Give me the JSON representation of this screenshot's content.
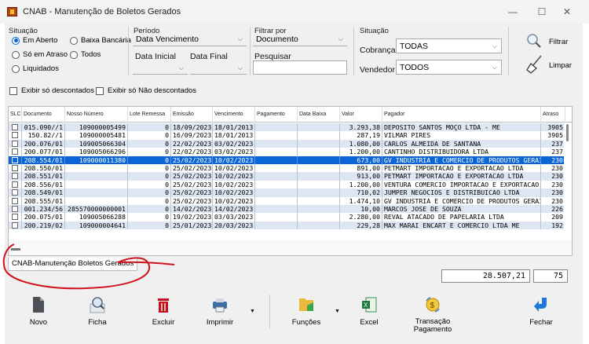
{
  "window": {
    "title": "CNAB - Manutenção de Boletos Gerados",
    "minimize": "—",
    "maximize": "☐",
    "close": "✕"
  },
  "situacao": {
    "label": "Situação",
    "options": [
      "Em Aberto",
      "Baixa Bancária",
      "Só em Atraso",
      "Todos",
      "Liquidados"
    ],
    "selected": "Em Aberto"
  },
  "periodo": {
    "label": "Período",
    "type_value": "Data Vencimento",
    "data_inicial_label": "Data Inicial",
    "data_final_label": "Data Final"
  },
  "filtrar": {
    "label": "Filtrar por",
    "value": "Documento",
    "pesquisar_label": "Pesquisar"
  },
  "situacao2": {
    "label": "Situação",
    "cobranca_label": "Cobrança",
    "cobranca_value": "TODAS",
    "vendedor_label": "Vendedor",
    "vendedor_value": "TODOS"
  },
  "actions": {
    "filtrar": "Filtrar",
    "limpar": "Limpar"
  },
  "checks": {
    "descontados": "Exibir só  descontados",
    "nao_descontados": "Exibir só Não descontados"
  },
  "grid": {
    "columns": [
      "SLC",
      "Documento",
      "Nosso Número",
      "Lote Remessa",
      "Emissão",
      "Vencimento",
      "Pagamento",
      "Data Baixa",
      "Valor",
      "Pagador",
      "Atraso"
    ],
    "rows": [
      {
        "doc": "015.090//1",
        "nosso": "109000005499",
        "lote": "0",
        "emissao": "18/09/2023",
        "venc": "18/01/2013",
        "pag": "",
        "baixa": "",
        "valor": "3.293,38",
        "pagador": "DEPOSITO SANTOS MOÇO LTDA - ME",
        "atraso": "3905"
      },
      {
        "doc": "150.82//1",
        "nosso": "109000005481",
        "lote": "0",
        "emissao": "16/09/2023",
        "venc": "18/01/2013",
        "pag": "",
        "baixa": "",
        "valor": "287,19",
        "pagador": "VILMAR PIRES",
        "atraso": "3905"
      },
      {
        "doc": "200.076/01",
        "nosso": "109005066304",
        "lote": "0",
        "emissao": "22/02/2023",
        "venc": "03/02/2023",
        "pag": "",
        "baixa": "",
        "valor": "1.080,00",
        "pagador": "CARLOS ALMEIDA DE SANTANA",
        "atraso": "237"
      },
      {
        "doc": "200.077/01",
        "nosso": "109005066296",
        "lote": "0",
        "emissao": "22/02/2023",
        "venc": "03/02/2023",
        "pag": "",
        "baixa": "",
        "valor": "1.200,00",
        "pagador": "CANTINHO DISTRIBUIDORA LTDA",
        "atraso": "237"
      },
      {
        "doc": "208.554/01",
        "nosso": "109000011380",
        "lote": "0",
        "emissao": "25/02/2023",
        "venc": "10/02/2023",
        "pag": "",
        "baixa": "",
        "valor": "673,00",
        "pagador": "GV INDUSTRIA E COMERCIO DE PRODUTOS GERAI",
        "atraso": "230"
      },
      {
        "doc": "208.550/01",
        "nosso": "",
        "lote": "0",
        "emissao": "25/02/2023",
        "venc": "10/02/2023",
        "pag": "",
        "baixa": "",
        "valor": "891,00",
        "pagador": "PETMART IMPORTACAO E EXPORTACAO LTDA",
        "atraso": "230"
      },
      {
        "doc": "208.551/01",
        "nosso": "",
        "lote": "0",
        "emissao": "25/02/2023",
        "venc": "10/02/2023",
        "pag": "",
        "baixa": "",
        "valor": "913,00",
        "pagador": "PETMART IMPORTACAO E EXPORTACAO LTDA",
        "atraso": "230"
      },
      {
        "doc": "208.556/01",
        "nosso": "",
        "lote": "0",
        "emissao": "25/02/2023",
        "venc": "10/02/2023",
        "pag": "",
        "baixa": "",
        "valor": "1.200,00",
        "pagador": "VENTURA COMERCIO IMPORTACAO E EXPORTACAO",
        "atraso": "230"
      },
      {
        "doc": "208.549/01",
        "nosso": "",
        "lote": "0",
        "emissao": "25/02/2023",
        "venc": "10/02/2023",
        "pag": "",
        "baixa": "",
        "valor": "710,02",
        "pagador": "JUMPER NEGOCIOS E DISTRIBUICAO LTDA",
        "atraso": "230"
      },
      {
        "doc": "208.555/01",
        "nosso": "",
        "lote": "0",
        "emissao": "25/02/2023",
        "venc": "10/02/2023",
        "pag": "",
        "baixa": "",
        "valor": "1.474,10",
        "pagador": "GV INDUSTRIA E COMERCIO DE PRODUTOS GERAI",
        "atraso": "230"
      },
      {
        "doc": "001.234/56",
        "nosso": "285570000000001",
        "lote": "0",
        "emissao": "14/02/2023",
        "venc": "14/02/2023",
        "pag": "",
        "baixa": "",
        "valor": "10,00",
        "pagador": "MARCOS JOSE DE SOUZA",
        "atraso": "226"
      },
      {
        "doc": "200.075/01",
        "nosso": "109005066288",
        "lote": "0",
        "emissao": "19/02/2023",
        "venc": "03/03/2023",
        "pag": "",
        "baixa": "",
        "valor": "2.280,00",
        "pagador": "REVAL ATACADO DE PAPELARIA LTDA",
        "atraso": "209"
      },
      {
        "doc": "200.219/02",
        "nosso": "109000004641",
        "lote": "0",
        "emissao": "25/01/2023",
        "venc": "20/03/2023",
        "pag": "",
        "baixa": "",
        "valor": "229,28",
        "pagador": "MAX MARAI ENCART E COMERCIO LTDA ME",
        "atraso": "192"
      }
    ],
    "selected_row": 4
  },
  "tab": {
    "label": "CNAB-Manutenção Boletos Gerados"
  },
  "totals": {
    "sum": "28.507,21",
    "count": "75"
  },
  "toolbar": {
    "novo": "Novo",
    "ficha": "Ficha",
    "excluir": "Excluir",
    "imprimir": "Imprimir",
    "funcoes": "Funções",
    "excel": "Excel",
    "transacao": "Transação Pagamento",
    "fechar": "Fechar"
  },
  "colors": {
    "selection": "#0a66d6",
    "alt_row": "#dde6f2",
    "annotation": "#d0121e",
    "excluir_red": "#c4121c",
    "fechar_blue": "#1e7ad6"
  }
}
